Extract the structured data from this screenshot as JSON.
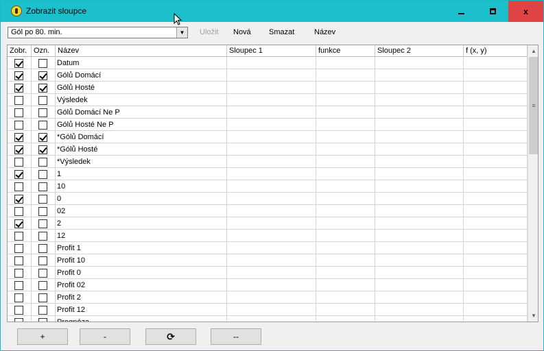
{
  "window": {
    "title": "Zobrazit sloupce",
    "icon": "app-coin-icon",
    "min_glyph": "minimize-icon",
    "max_glyph": "maximize-icon",
    "close_label": "x"
  },
  "toolbar": {
    "combo_value": "Gól po 80. min.",
    "combo_arrow": "▼",
    "save_label": "Uložit",
    "new_label": "Nová",
    "delete_label": "Smazat",
    "name_label": "Název"
  },
  "grid": {
    "headers": [
      "Zobr.",
      "Ozn.",
      "Název",
      "Sloupec 1",
      "funkce",
      "Sloupec 2",
      "f (x, y)"
    ],
    "rows": [
      {
        "show": true,
        "mark": false,
        "name": "Datum"
      },
      {
        "show": true,
        "mark": true,
        "name": "Gólů Domácí"
      },
      {
        "show": true,
        "mark": true,
        "name": "Gólů Hosté"
      },
      {
        "show": false,
        "mark": false,
        "name": "Výsledek"
      },
      {
        "show": false,
        "mark": false,
        "name": "Gólů Domácí Ne P"
      },
      {
        "show": false,
        "mark": false,
        "name": "Gólů Hosté Ne P"
      },
      {
        "show": true,
        "mark": true,
        "name": "*Gólů Domácí"
      },
      {
        "show": true,
        "mark": true,
        "name": "*Gólů Hosté"
      },
      {
        "show": false,
        "mark": false,
        "name": "*Výsledek"
      },
      {
        "show": true,
        "mark": false,
        "name": "1"
      },
      {
        "show": false,
        "mark": false,
        "name": "10"
      },
      {
        "show": true,
        "mark": false,
        "name": "0"
      },
      {
        "show": false,
        "mark": false,
        "name": "02"
      },
      {
        "show": true,
        "mark": false,
        "name": "2"
      },
      {
        "show": false,
        "mark": false,
        "name": "12"
      },
      {
        "show": false,
        "mark": false,
        "name": "Profit 1"
      },
      {
        "show": false,
        "mark": false,
        "name": "Profit 10"
      },
      {
        "show": false,
        "mark": false,
        "name": "Profit 0"
      },
      {
        "show": false,
        "mark": false,
        "name": "Profit 02"
      },
      {
        "show": false,
        "mark": false,
        "name": "Profit 2"
      },
      {
        "show": false,
        "mark": false,
        "name": "Profit 12"
      },
      {
        "show": false,
        "mark": false,
        "name": "Prognóza"
      }
    ]
  },
  "scrollbar": {
    "up_glyph": "▲",
    "down_glyph": "▼",
    "thumb_glyph": "≡"
  },
  "footer": {
    "add_label": "+",
    "remove_label": "-",
    "refresh_glyph": "⟳",
    "clear_label": "--"
  }
}
